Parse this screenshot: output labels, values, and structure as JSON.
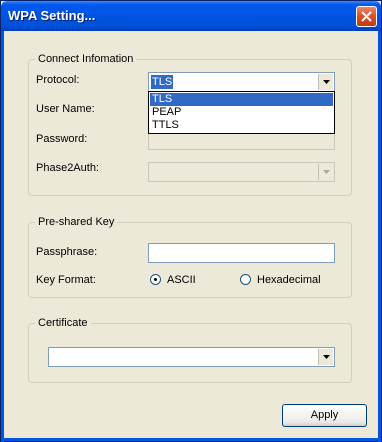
{
  "window": {
    "title": "WPA Setting...",
    "close_icon": "close-icon"
  },
  "connect": {
    "legend": "Connect Infomation",
    "protocol_label": "Protocol:",
    "protocol_value": "TLS",
    "protocol_options": [
      "TLS",
      "PEAP",
      "TTLS"
    ],
    "username_label": "User Name:",
    "password_label": "Password:",
    "phase2_label": "Phase2Auth:"
  },
  "psk": {
    "legend": "Pre-shared Key",
    "passphrase_label": "Passphrase:",
    "key_format_label": "Key Format:",
    "ascii_label": "ASCII",
    "hex_label": "Hexadecimal",
    "selected_format": "ASCII"
  },
  "certificate": {
    "legend": "Certificate",
    "value": ""
  },
  "apply_label": "Apply",
  "colors": {
    "title_bar": "#0054e3",
    "selection": "#316ac5",
    "dialog_bg": "#ece9d8"
  }
}
